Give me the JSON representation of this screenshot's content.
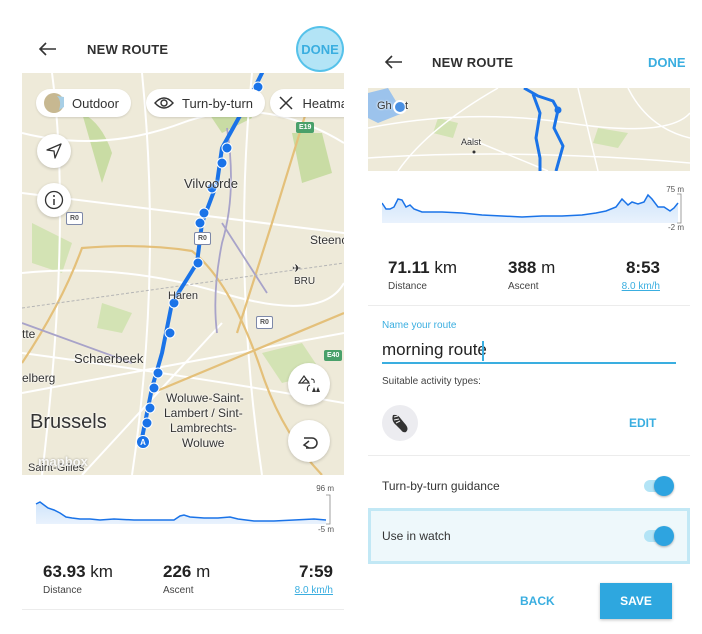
{
  "left": {
    "header": {
      "title": "NEW ROUTE",
      "done_label": "DONE"
    },
    "map": {
      "chips": [
        {
          "label": "Outdoor",
          "icon": "map-thumbnail-icon"
        },
        {
          "label": "Turn-by-turn",
          "icon": "eye-icon"
        },
        {
          "label": "Heatma",
          "icon": "close-icon"
        }
      ],
      "places": [
        "Vilvoorde",
        "Steenc",
        "BRU",
        "Haren",
        "Schaerbeek",
        "tte",
        "elberg",
        "Brussels",
        "Woluwe-Saint-",
        "Lambert / Sint-",
        "Lambrechts-",
        "Woluwe",
        "Saint-Gilles"
      ],
      "road_shields": [
        "E19",
        "R0",
        "R0",
        "R0",
        "E40"
      ],
      "start_marker": "A",
      "attribution": "mapbox"
    },
    "elevation": {
      "max_label": "96 m",
      "min_label": "-5 m"
    },
    "stats": {
      "distance_value": "63.93",
      "distance_unit": "km",
      "distance_label": "Distance",
      "ascent_value": "226",
      "ascent_unit": "m",
      "ascent_label": "Ascent",
      "time_value": "7:59",
      "speed_label": "8.0 km/h"
    }
  },
  "right": {
    "header": {
      "title": "NEW ROUTE",
      "done_label": "DONE"
    },
    "map": {
      "places": [
        "Gh",
        "t",
        "Aalst"
      ]
    },
    "elevation": {
      "max_label": "75 m",
      "min_label": "-2 m"
    },
    "stats": {
      "distance_value": "71.11",
      "distance_unit": "km",
      "distance_label": "Distance",
      "ascent_value": "388",
      "ascent_unit": "m",
      "ascent_label": "Ascent",
      "time_value": "8:53",
      "speed_label": "8.0 km/h"
    },
    "form": {
      "name_label": "Name your route",
      "name_value": "morning route",
      "activity_label": "Suitable activity types:",
      "activity_icon": "running-shoe-icon",
      "edit_label": "EDIT"
    },
    "toggles": [
      {
        "label": "Turn-by-turn guidance",
        "on": true
      },
      {
        "label": "Use in watch",
        "on": true
      }
    ],
    "buttons": {
      "back_label": "BACK",
      "save_label": "SAVE"
    }
  },
  "colors": {
    "accent": "#3aaee0",
    "route": "#1a73e8",
    "map_bg": "#eeead9"
  }
}
